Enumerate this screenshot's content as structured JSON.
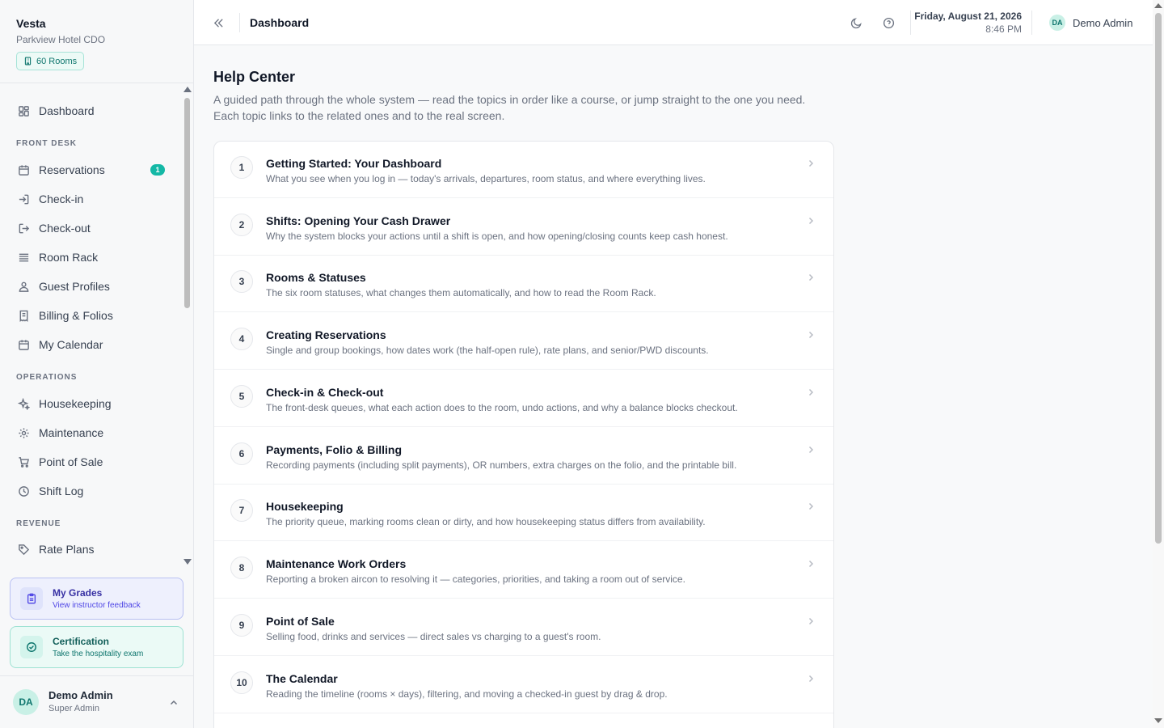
{
  "brand": {
    "name": "Vesta",
    "property": "Parkview Hotel CDO",
    "rooms_badge": "60 Rooms"
  },
  "sidebar": {
    "dashboard": "Dashboard",
    "front_desk_label": "FRONT DESK",
    "reservations": "Reservations",
    "reservations_count": "1",
    "checkin": "Check-in",
    "checkout": "Check-out",
    "room_rack": "Room Rack",
    "guest_profiles": "Guest Profiles",
    "billing": "Billing & Folios",
    "my_calendar": "My Calendar",
    "operations_label": "OPERATIONS",
    "housekeeping": "Housekeeping",
    "maintenance": "Maintenance",
    "pos": "Point of Sale",
    "shift_log": "Shift Log",
    "revenue_label": "REVENUE",
    "rate_plans": "Rate Plans"
  },
  "promos": {
    "grades_title": "My Grades",
    "grades_sub": "View instructor feedback",
    "cert_title": "Certification",
    "cert_sub": "Take the hospitality exam"
  },
  "user": {
    "initials": "DA",
    "name": "Demo Admin",
    "role": "Super Admin"
  },
  "topbar": {
    "title": "Dashboard",
    "date": "Friday, August 21, 2026",
    "time": "8:46 PM",
    "user_initials": "DA",
    "user_name": "Demo Admin"
  },
  "main": {
    "title": "Help Center",
    "description_line1": "A guided path through the whole system — read the topics in order like a course, or jump straight to the one you need.",
    "description_line2": "Each topic links to the related ones and to the real screen.",
    "topics": [
      {
        "num": "1",
        "title": "Getting Started: Your Dashboard",
        "desc": "What you see when you log in — today's arrivals, departures, room status, and where everything lives."
      },
      {
        "num": "2",
        "title": "Shifts: Opening Your Cash Drawer",
        "desc": "Why the system blocks your actions until a shift is open, and how opening/closing counts keep cash honest."
      },
      {
        "num": "3",
        "title": "Rooms & Statuses",
        "desc": "The six room statuses, what changes them automatically, and how to read the Room Rack."
      },
      {
        "num": "4",
        "title": "Creating Reservations",
        "desc": "Single and group bookings, how dates work (the half-open rule), rate plans, and senior/PWD discounts."
      },
      {
        "num": "5",
        "title": "Check-in & Check-out",
        "desc": "The front-desk queues, what each action does to the room, undo actions, and why a balance blocks checkout."
      },
      {
        "num": "6",
        "title": "Payments, Folio & Billing",
        "desc": "Recording payments (including split payments), OR numbers, extra charges on the folio, and the printable bill."
      },
      {
        "num": "7",
        "title": "Housekeeping",
        "desc": "The priority queue, marking rooms clean or dirty, and how housekeeping status differs from availability."
      },
      {
        "num": "8",
        "title": "Maintenance Work Orders",
        "desc": "Reporting a broken aircon to resolving it — categories, priorities, and taking a room out of service."
      },
      {
        "num": "9",
        "title": "Point of Sale",
        "desc": "Selling food, drinks and services — direct sales vs charging to a guest's room."
      },
      {
        "num": "10",
        "title": "The Calendar",
        "desc": "Reading the timeline (rooms × days), filtering, and moving a checked-in guest by drag & drop."
      }
    ]
  }
}
